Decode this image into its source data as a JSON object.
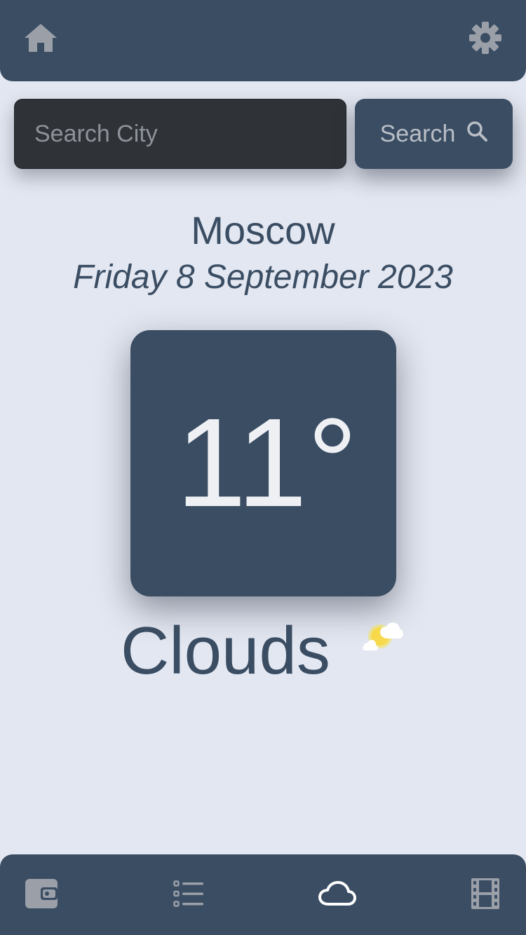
{
  "header": {
    "home_icon": "home-icon",
    "settings_icon": "gear-icon"
  },
  "search": {
    "placeholder": "Search City",
    "value": "",
    "button_label": "Search",
    "button_icon": "search-icon"
  },
  "location": {
    "city": "Moscow",
    "date": "Friday 8 September 2023"
  },
  "weather": {
    "temperature": "11°",
    "condition": "Clouds",
    "condition_icon": "partly-cloudy-icon"
  },
  "bottom_nav": {
    "items": [
      {
        "icon": "wallet-icon",
        "active": false
      },
      {
        "icon": "list-icon",
        "active": false
      },
      {
        "icon": "cloud-icon",
        "active": true
      },
      {
        "icon": "film-icon",
        "active": false
      }
    ]
  },
  "colors": {
    "background": "#e3e7f1",
    "primary": "#3a4d63",
    "input_background": "#2f3237",
    "icon_inactive": "#9a9fa8",
    "icon_active": "#ffffff",
    "temperature_text": "#eef0f4"
  }
}
